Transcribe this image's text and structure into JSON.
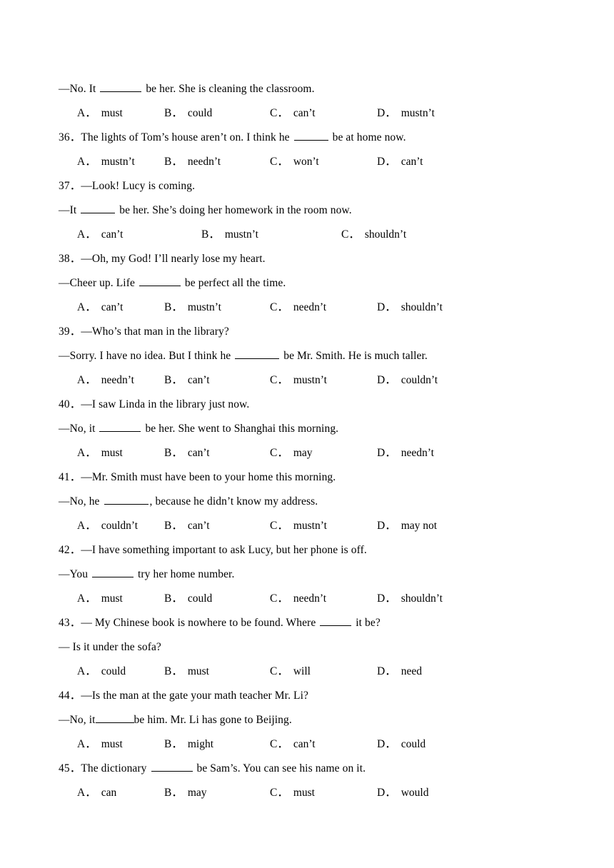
{
  "document": {
    "type": "english-grammar-worksheet",
    "topic": "modal verbs multiple choice",
    "text_color": "#000000",
    "background_color": "#ffffff"
  },
  "blocks": [
    {
      "id": "q35-continued",
      "number": "",
      "lines": [
        {
          "kind": "reply",
          "pre": "—No. It ",
          "blank": "w1",
          "post": " be her. She is cleaning the classroom."
        }
      ],
      "options": {
        "columns": 4,
        "items": [
          {
            "label": "A．",
            "value": "must"
          },
          {
            "label": "B．",
            "value": "could"
          },
          {
            "label": "C．",
            "value": "can’t"
          },
          {
            "label": "D．",
            "value": "mustn’t"
          }
        ]
      }
    },
    {
      "id": "q36",
      "number": "36．",
      "lines": [
        {
          "kind": "stem",
          "pre": "The lights of Tom’s house aren’t on. I think he ",
          "blank": "w2",
          "post": " be at home now."
        }
      ],
      "options": {
        "columns": 4,
        "items": [
          {
            "label": "A．",
            "value": "mustn’t"
          },
          {
            "label": "B．",
            "value": "needn’t"
          },
          {
            "label": "C．",
            "value": "won’t"
          },
          {
            "label": "D．",
            "value": "can’t"
          }
        ]
      }
    },
    {
      "id": "q37",
      "number": "37．",
      "lines": [
        {
          "kind": "stem",
          "pre": "—Look! Lucy is coming.",
          "blank": "",
          "post": ""
        },
        {
          "kind": "reply",
          "pre": "—It ",
          "blank": "w2",
          "post": " be her. She’s doing her homework in the room now."
        }
      ],
      "options": {
        "columns": 3,
        "items": [
          {
            "label": "A．",
            "value": "can’t"
          },
          {
            "label": "B．",
            "value": "mustn’t"
          },
          {
            "label": "C．",
            "value": "shouldn’t"
          }
        ]
      }
    },
    {
      "id": "q38",
      "number": "38．",
      "lines": [
        {
          "kind": "stem",
          "pre": "—Oh, my God! I’ll nearly lose my heart.",
          "blank": "",
          "post": ""
        },
        {
          "kind": "reply",
          "pre": "—Cheer up. Life ",
          "blank": "w1",
          "post": " be perfect all the time."
        }
      ],
      "options": {
        "columns": 4,
        "items": [
          {
            "label": "A．",
            "value": "can’t"
          },
          {
            "label": "B．",
            "value": "mustn’t"
          },
          {
            "label": "C．",
            "value": "needn’t"
          },
          {
            "label": "D．",
            "value": "shouldn’t"
          }
        ]
      }
    },
    {
      "id": "q39",
      "number": "39．",
      "lines": [
        {
          "kind": "stem",
          "pre": "—Who’s that man in the library?",
          "blank": "",
          "post": ""
        },
        {
          "kind": "reply",
          "pre": "—Sorry. I have no idea. But I think he ",
          "blank": "w3",
          "post": " be Mr. Smith. He is much taller."
        }
      ],
      "options": {
        "columns": 4,
        "items": [
          {
            "label": "A．",
            "value": "needn’t"
          },
          {
            "label": "B．",
            "value": "can’t"
          },
          {
            "label": "C．",
            "value": "mustn’t"
          },
          {
            "label": "D．",
            "value": "couldn’t"
          }
        ]
      }
    },
    {
      "id": "q40",
      "number": "40．",
      "lines": [
        {
          "kind": "stem",
          "pre": "—I saw Linda in the library just now.",
          "blank": "",
          "post": ""
        },
        {
          "kind": "reply",
          "pre": "—No, it ",
          "blank": "w1",
          "post": " be her. She went to Shanghai this morning."
        }
      ],
      "options": {
        "columns": 4,
        "items": [
          {
            "label": "A．",
            "value": "must"
          },
          {
            "label": "B．",
            "value": "can’t"
          },
          {
            "label": "C．",
            "value": "may"
          },
          {
            "label": "D．",
            "value": "needn’t"
          }
        ]
      }
    },
    {
      "id": "q41",
      "number": "41．",
      "lines": [
        {
          "kind": "stem",
          "pre": "—Mr. Smith must have been to your home this morning.",
          "blank": "",
          "post": ""
        },
        {
          "kind": "reply",
          "pre": "—No, he ",
          "blank": "w3",
          "post": ", because he didn’t know my address."
        }
      ],
      "options": {
        "columns": 4,
        "items": [
          {
            "label": "A．",
            "value": "couldn’t"
          },
          {
            "label": "B．",
            "value": "can’t"
          },
          {
            "label": "C．",
            "value": "mustn’t"
          },
          {
            "label": "D．",
            "value": "may not"
          }
        ]
      }
    },
    {
      "id": "q42",
      "number": "42．",
      "lines": [
        {
          "kind": "stem",
          "pre": "—I have something important to ask Lucy, but her phone is off.",
          "blank": "",
          "post": ""
        },
        {
          "kind": "reply",
          "pre": "—You ",
          "blank": "w1",
          "post": " try her home number."
        }
      ],
      "options": {
        "columns": 4,
        "items": [
          {
            "label": "A．",
            "value": "must"
          },
          {
            "label": "B．",
            "value": "could"
          },
          {
            "label": "C．",
            "value": "needn’t"
          },
          {
            "label": "D．",
            "value": "shouldn’t"
          }
        ]
      }
    },
    {
      "id": "q43",
      "number": "43．",
      "lines": [
        {
          "kind": "stem",
          "pre": "— My Chinese book is nowhere to be found. Where ",
          "blank": "w4",
          "post": " it be?"
        },
        {
          "kind": "reply",
          "pre": "— Is it under the sofa?",
          "blank": "",
          "post": ""
        }
      ],
      "options": {
        "columns": 4,
        "items": [
          {
            "label": "A．",
            "value": "could"
          },
          {
            "label": "B．",
            "value": "must"
          },
          {
            "label": "C．",
            "value": "will"
          },
          {
            "label": "D．",
            "value": "need"
          }
        ]
      }
    },
    {
      "id": "q44",
      "number": "44．",
      "lines": [
        {
          "kind": "stem",
          "pre": "—Is the man at the gate your math teacher Mr. Li?",
          "blank": "",
          "post": ""
        },
        {
          "kind": "reply",
          "pre": "—No, it",
          "blank": "w5",
          "post": "be him. Mr. Li has gone to Beijing.",
          "tight": true
        }
      ],
      "options": {
        "columns": 4,
        "items": [
          {
            "label": "A．",
            "value": "must"
          },
          {
            "label": "B．",
            "value": "might"
          },
          {
            "label": "C．",
            "value": "can’t"
          },
          {
            "label": "D．",
            "value": "could"
          }
        ]
      }
    },
    {
      "id": "q45",
      "number": "45．",
      "lines": [
        {
          "kind": "stem",
          "pre": "The dictionary ",
          "blank": "w1",
          "post": " be Sam’s. You can see his name on it."
        }
      ],
      "options": {
        "columns": 4,
        "items": [
          {
            "label": "A．",
            "value": "can"
          },
          {
            "label": "B．",
            "value": "may"
          },
          {
            "label": "C．",
            "value": "must"
          },
          {
            "label": "D．",
            "value": "would"
          }
        ]
      }
    }
  ]
}
